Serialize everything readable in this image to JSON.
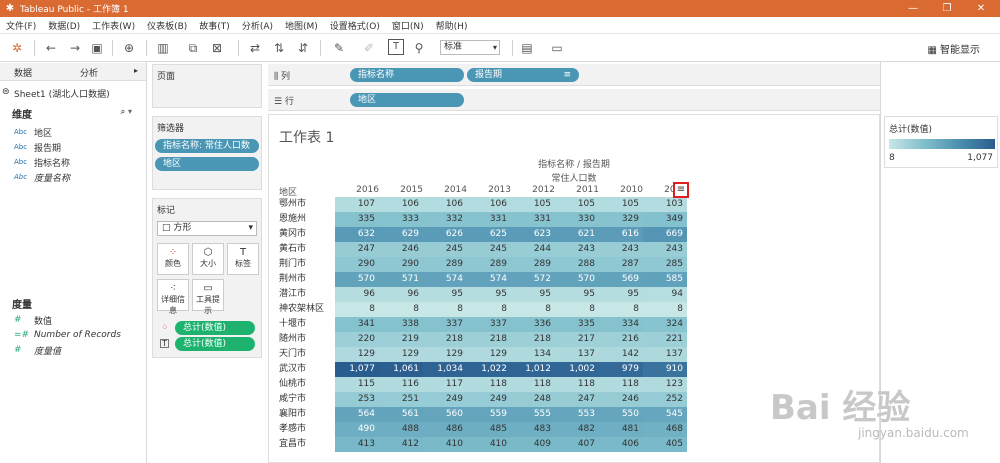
{
  "titlebar": {
    "title": "Tableau Public - 工作簿 1"
  },
  "menu": [
    "文件(F)",
    "数据(D)",
    "工作表(W)",
    "仪表板(B)",
    "故事(T)",
    "分析(A)",
    "地图(M)",
    "设置格式(O)",
    "窗口(N)",
    "帮助(H)"
  ],
  "toolbar": {
    "fit_combo": "标准",
    "show_me": "智能显示"
  },
  "left": {
    "tab_data": "数据",
    "tab_analysis": "分析",
    "datasource": "Sheet1 (湖北人口数据)",
    "dimensions_header": "维度",
    "dimensions": [
      {
        "type": "Abc",
        "name": "地区"
      },
      {
        "type": "Abc",
        "name": "报告期"
      },
      {
        "type": "Abc",
        "name": "指标名称"
      },
      {
        "type": "Abc",
        "name": "度量名称",
        "italic": true
      }
    ],
    "measures_header": "度量",
    "measures": [
      {
        "type": "#",
        "name": "数值"
      },
      {
        "type": "=#",
        "name": "Number of Records",
        "italic": true
      },
      {
        "type": "#",
        "name": "度量值",
        "italic": true
      }
    ]
  },
  "cards": {
    "pages": "页面",
    "filters": "筛选器",
    "filter_pills": [
      "指标名称: 常住人口数",
      "地区"
    ],
    "marks": "标记",
    "mark_type": "方形",
    "mark_buttons": [
      "颜色",
      "大小",
      "标签",
      "详细信息",
      "工具提示"
    ],
    "mark_pills": [
      "总计(数值)",
      "总计(数值)"
    ]
  },
  "shelves": {
    "columns_label": "列",
    "rows_label": "行",
    "column_pills": [
      "指标名称",
      "报告期"
    ],
    "row_pills": [
      "地区"
    ]
  },
  "sheet": {
    "title": "工作表 1",
    "header1": "指标名称 / 报告期",
    "header2": "常住人口数",
    "row_header": "地区"
  },
  "legend": {
    "title": "总计(数值)",
    "min": "8",
    "max": "1,077"
  },
  "watermark": {
    "logo": "Bai 经验",
    "url": "jingyan.baidu.com"
  },
  "chart_data": {
    "type": "table",
    "columns": [
      "2016",
      "2015",
      "2014",
      "2013",
      "2012",
      "2011",
      "2010",
      "2009"
    ],
    "rows": [
      {
        "region": "鄂州市",
        "values": [
          107,
          106,
          106,
          106,
          105,
          105,
          105,
          103
        ]
      },
      {
        "region": "恩施州",
        "values": [
          335,
          333,
          332,
          331,
          331,
          330,
          329,
          349
        ]
      },
      {
        "region": "黄冈市",
        "values": [
          632,
          629,
          626,
          625,
          623,
          621,
          616,
          669
        ]
      },
      {
        "region": "黄石市",
        "values": [
          247,
          246,
          245,
          245,
          244,
          243,
          243,
          243
        ]
      },
      {
        "region": "荆门市",
        "values": [
          290,
          290,
          289,
          289,
          289,
          288,
          287,
          285
        ]
      },
      {
        "region": "荆州市",
        "values": [
          570,
          571,
          574,
          574,
          572,
          570,
          569,
          585
        ]
      },
      {
        "region": "潜江市",
        "values": [
          96,
          96,
          95,
          95,
          95,
          95,
          95,
          94
        ]
      },
      {
        "region": "神农架林区",
        "values": [
          8,
          8,
          8,
          8,
          8,
          8,
          8,
          8
        ]
      },
      {
        "region": "十堰市",
        "values": [
          341,
          338,
          337,
          337,
          336,
          335,
          334,
          324
        ]
      },
      {
        "region": "随州市",
        "values": [
          220,
          219,
          218,
          218,
          218,
          217,
          216,
          221
        ]
      },
      {
        "region": "天门市",
        "values": [
          129,
          129,
          129,
          129,
          134,
          137,
          142,
          137
        ]
      },
      {
        "region": "武汉市",
        "values": [
          1077,
          1061,
          1034,
          1022,
          1012,
          1002,
          979,
          910
        ]
      },
      {
        "region": "仙桃市",
        "values": [
          115,
          116,
          117,
          118,
          118,
          118,
          118,
          123
        ]
      },
      {
        "region": "咸宁市",
        "values": [
          253,
          251,
          249,
          249,
          248,
          247,
          246,
          252
        ]
      },
      {
        "region": "襄阳市",
        "values": [
          564,
          561,
          560,
          559,
          555,
          553,
          550,
          545
        ]
      },
      {
        "region": "孝感市",
        "values": [
          490,
          488,
          486,
          485,
          483,
          482,
          481,
          468
        ]
      },
      {
        "region": "宜昌市",
        "values": [
          413,
          412,
          410,
          410,
          409,
          407,
          406,
          405
        ]
      }
    ],
    "color_range": [
      8,
      1077
    ]
  }
}
